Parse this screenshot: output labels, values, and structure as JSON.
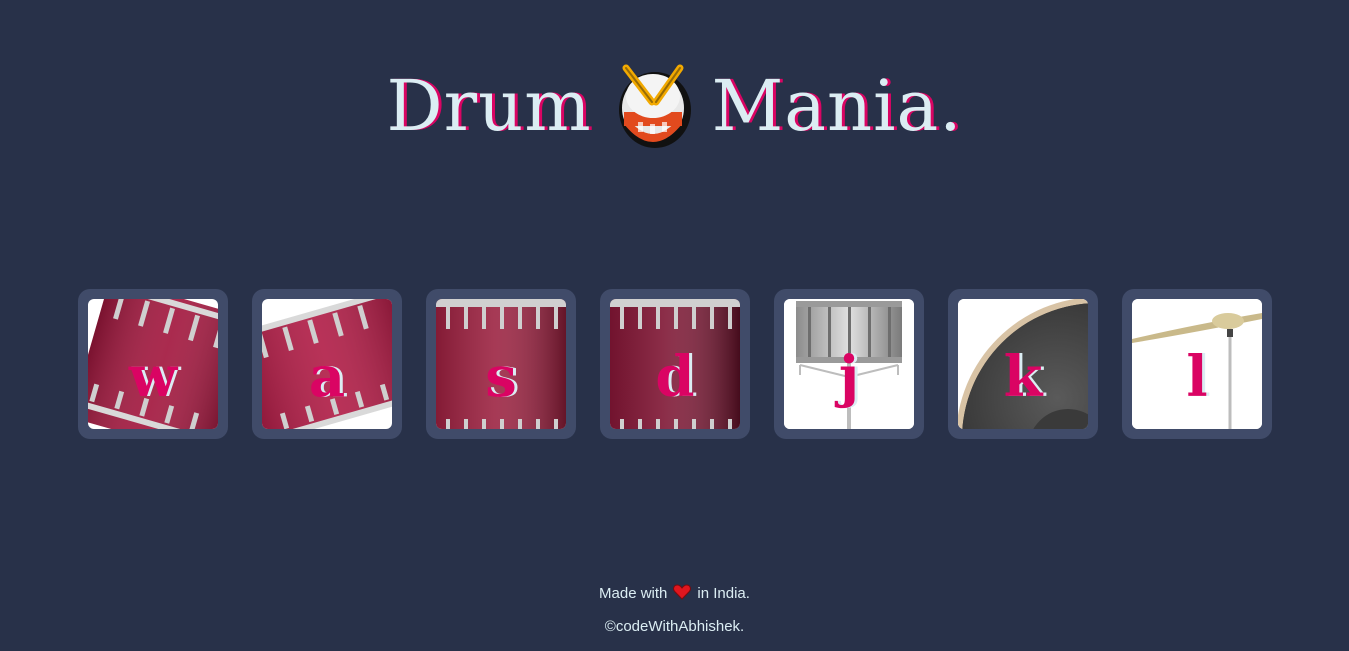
{
  "header": {
    "title_left": "Drum",
    "title_right": "Mania."
  },
  "drums": [
    {
      "key": "w",
      "name": "tom-1"
    },
    {
      "key": "a",
      "name": "tom-2"
    },
    {
      "key": "s",
      "name": "tom-3"
    },
    {
      "key": "d",
      "name": "tom-4"
    },
    {
      "key": "j",
      "name": "snare"
    },
    {
      "key": "k",
      "name": "kick-bass"
    },
    {
      "key": "l",
      "name": "crash"
    }
  ],
  "footer": {
    "made_with_prefix": "Made with",
    "made_with_suffix": "in India.",
    "credit": "©codeWithAbhishek."
  },
  "colors": {
    "background": "#283149",
    "tile": "#404B69",
    "accent": "#DA0463",
    "text": "#DBEDF3"
  },
  "icons": {
    "title_icon": "drum-emoji-icon",
    "footer_icon": "heart-icon"
  }
}
